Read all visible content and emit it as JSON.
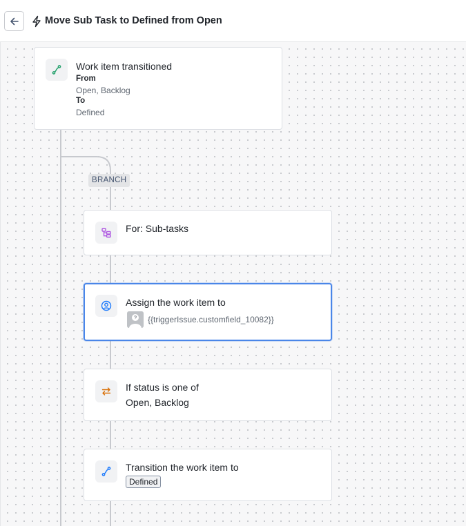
{
  "header": {
    "back_icon": "arrow-left-icon",
    "bolt_icon": "lightning-bolt-icon",
    "title": "Move Sub Task to Defined from Open"
  },
  "trigger": {
    "icon": "transition-icon",
    "title": "Work item transitioned",
    "from_label": "From",
    "from_value": "Open, Backlog",
    "to_label": "To",
    "to_value": "Defined"
  },
  "branch": {
    "label": "BRANCH"
  },
  "steps": {
    "for_each": {
      "icon": "subtasks-icon",
      "title": "For: Sub-tasks"
    },
    "assign": {
      "icon": "user-circle-icon",
      "title": "Assign the work item to",
      "avatar_icon": "default-avatar-icon",
      "value": "{{triggerIssue.customfield_10082}}"
    },
    "condition": {
      "icon": "swap-arrows-icon",
      "title_line1": "If status is one of",
      "title_line2": "Open, Backlog"
    },
    "transition": {
      "icon": "transition-icon",
      "title": "Transition the work item to",
      "status": "Defined"
    }
  },
  "colors": {
    "trigger_icon": "#22a06b",
    "subtasks_icon": "#af59e1",
    "assign_icon": "#1d7afc",
    "condition_icon": "#d97008",
    "transition_icon": "#1d7afc",
    "selected_border": "#4a86e8"
  }
}
